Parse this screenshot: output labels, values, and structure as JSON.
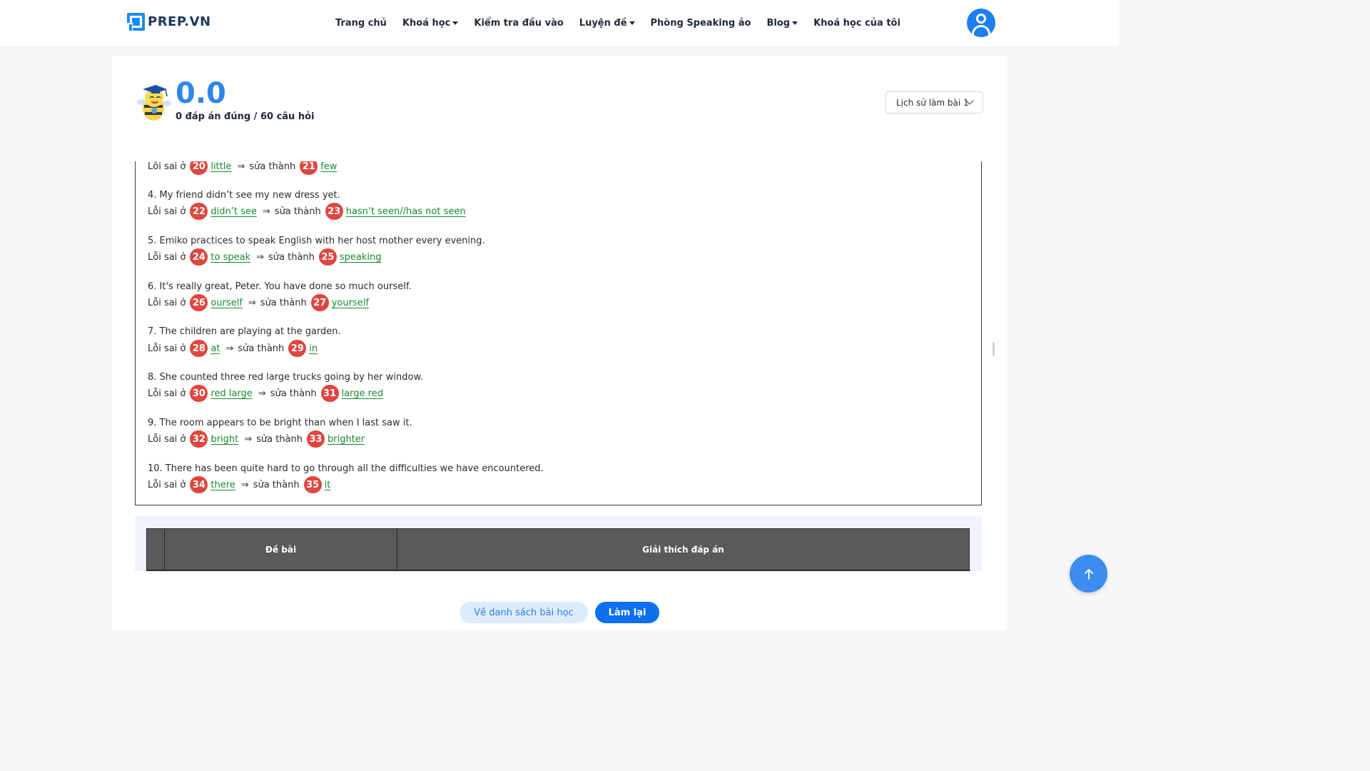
{
  "header": {
    "logo_text": "PREP.VN",
    "nav": [
      {
        "label": "Trang chủ",
        "dropdown": false
      },
      {
        "label": "Khoá học",
        "dropdown": true
      },
      {
        "label": "Kiểm tra đầu vào",
        "dropdown": false
      },
      {
        "label": "Luyện đề",
        "dropdown": true
      },
      {
        "label": "Phòng Speaking ảo",
        "dropdown": false
      },
      {
        "label": "Blog",
        "dropdown": true
      },
      {
        "label": "Khoá học của tôi",
        "dropdown": false
      }
    ],
    "avatar_icon": "user-icon"
  },
  "result": {
    "score": "0.0",
    "summary": "0 đáp án đúng / 60 câu hỏi",
    "history_select": "Lịch sử làm bài 1"
  },
  "labels": {
    "error_at": "Lỗi sai ở",
    "arrow": "⇒",
    "fix_to": "sửa thành"
  },
  "answers": [
    {
      "question": "",
      "wrong_no": "20",
      "wrong": "little",
      "fix_no": "21",
      "fix": "few"
    },
    {
      "question": "4. My friend didn’t see my new dress yet.",
      "wrong_no": "22",
      "wrong": "didn’t see",
      "fix_no": "23",
      "fix": "hasn’t seen//has not seen"
    },
    {
      "question": "5. Emiko practices to speak English with her host mother every evening.",
      "wrong_no": "24",
      "wrong": "to speak",
      "fix_no": "25",
      "fix": "speaking"
    },
    {
      "question": "6. It's really great, Peter. You have done so much ourself.",
      "wrong_no": "26",
      "wrong": "ourself",
      "fix_no": "27",
      "fix": "yourself"
    },
    {
      "question": "7. The children are playing at the garden.",
      "wrong_no": "28",
      "wrong": "at",
      "fix_no": "29",
      "fix": "in"
    },
    {
      "question": "8. She counted three red large trucks going by her window.",
      "wrong_no": "30",
      "wrong": "red large",
      "fix_no": "31",
      "fix": "large red"
    },
    {
      "question": "9. The room appears to be bright than when I last saw it.",
      "wrong_no": "32",
      "wrong": "bright",
      "fix_no": "33",
      "fix": "brighter"
    },
    {
      "question": "10. There has been quite hard to go through all the difficulties we have encountered.",
      "wrong_no": "34",
      "wrong": "there",
      "fix_no": "35",
      "fix": "it"
    }
  ],
  "table": {
    "col1": "Đề bài",
    "col2": "Giải thích đáp án"
  },
  "buttons": {
    "back": "Về danh sách bài học",
    "retry": "Làm lại"
  },
  "colors": {
    "accent": "#2d86ef",
    "badge": "#e0463f",
    "answer_text": "#168a2f",
    "primary_button": "#0e6ff0"
  }
}
